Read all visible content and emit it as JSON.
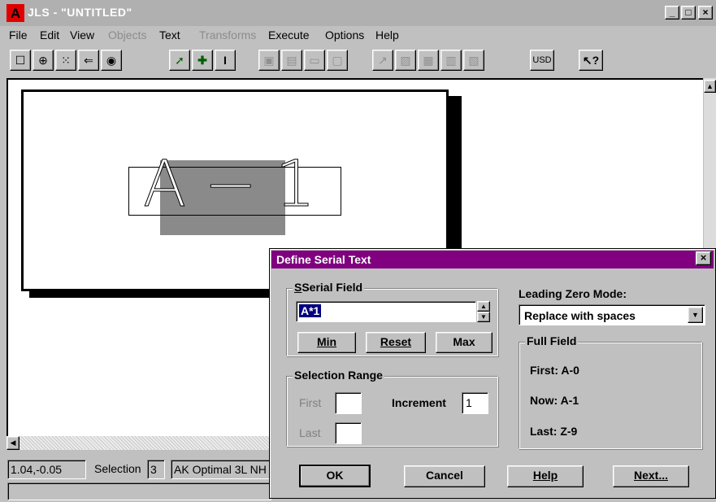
{
  "window": {
    "title": "JLS - \"UNTITLED\"",
    "buttons": {
      "minimize": "_",
      "maximize": "□",
      "close": "×"
    }
  },
  "menu": [
    {
      "label": "File",
      "enabled": true
    },
    {
      "label": "Edit",
      "enabled": true
    },
    {
      "label": "View",
      "enabled": true
    },
    {
      "label": "Objects",
      "enabled": false
    },
    {
      "label": "Text",
      "enabled": true
    },
    {
      "label": "Transforms",
      "enabled": false
    },
    {
      "label": "Execute",
      "enabled": true
    },
    {
      "label": "Options",
      "enabled": true
    },
    {
      "label": "Help",
      "enabled": true
    }
  ],
  "toolbar": {
    "usd_label": "USD",
    "help_glyph": "↖?"
  },
  "canvas": {
    "serial_text": "A−1"
  },
  "status": {
    "coords": "1.04,-0.05",
    "selection_label": "Selection",
    "selection_count": "3",
    "font": "AK Optimal 3L NH"
  },
  "dialog": {
    "title": "Define Serial Text",
    "close": "×",
    "serial_field": {
      "label": "Serial Field",
      "value": "A*1",
      "min": "Min",
      "reset": "Reset",
      "max": "Max"
    },
    "selection_range": {
      "label": "Selection Range",
      "first": "First",
      "last": "Last",
      "increment_label": "Increment",
      "increment_value": "1"
    },
    "leading_zero": {
      "label": "Leading Zero Mode:",
      "value": "Replace with spaces"
    },
    "full_field": {
      "label": "Full Field",
      "first": "First:  A-0",
      "now": "Now:  A-1",
      "last": "Last:  Z-9"
    },
    "buttons": {
      "ok": "OK",
      "cancel": "Cancel",
      "help": "Help",
      "next": "Next..."
    }
  }
}
